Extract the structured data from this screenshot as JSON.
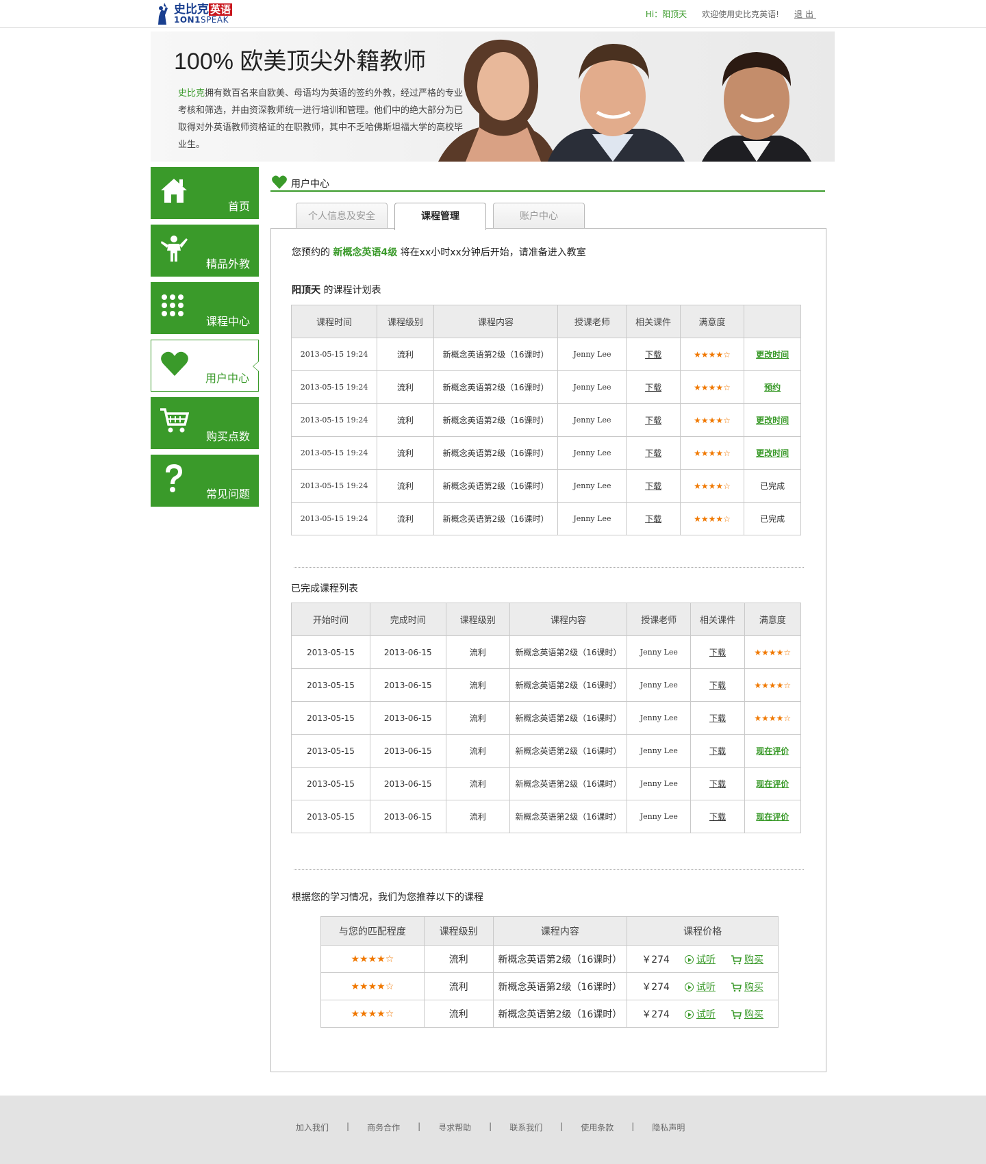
{
  "header": {
    "logo_cn": "史比克",
    "logo_cn_red": "英语",
    "logo_en_bold": "1ON1",
    "logo_en": "SPEAK",
    "greeting": "Hi：阳顶天",
    "welcome": "欢迎使用史比克英语!",
    "logout": "退出"
  },
  "banner": {
    "title": "100% 欧美顶尖外籍教师",
    "brand": "史比克",
    "text": "拥有数百名来自欧美、母语均为英语的签约外教，经过严格的专业考核和筛选，并由资深教师统一进行培训和管理。他们中的绝大部分为已取得对外英语教师资格证的在职教师，其中不乏哈佛斯坦福大学的高校毕业生。"
  },
  "sidebar": {
    "items": [
      {
        "label": "首页",
        "icon": "home-icon"
      },
      {
        "label": "精品外教",
        "icon": "teacher-icon"
      },
      {
        "label": "课程中心",
        "icon": "grid-icon"
      },
      {
        "label": "用户中心",
        "icon": "heart-icon",
        "active": true
      },
      {
        "label": "购买点数",
        "icon": "cart-icon"
      },
      {
        "label": "常见问题",
        "icon": "question-icon"
      }
    ]
  },
  "section": {
    "title": "用户中心"
  },
  "tabs": [
    "个人信息及安全",
    "课程管理",
    "账户中心"
  ],
  "notice": {
    "prefix": "您预约的",
    "course": "新概念英语4级",
    "suffix": "将在xx小时xx分钟后开始，请准备进入教室"
  },
  "plan": {
    "user": "阳顶天",
    "title_suffix": "的课程计划表",
    "headers": [
      "课程时间",
      "课程级别",
      "课程内容",
      "授课老师",
      "相关课件",
      "满意度",
      ""
    ],
    "rows": [
      {
        "time": "2013-05-15  19:24",
        "level": "流利",
        "content": "新概念英语第2级（16课时）",
        "teacher": "Jenny Lee",
        "file": "下载",
        "rating": 4,
        "action": "更改时间",
        "action_type": "link"
      },
      {
        "time": "2013-05-15  19:24",
        "level": "流利",
        "content": "新概念英语第2级（16课时）",
        "teacher": "Jenny Lee",
        "file": "下载",
        "rating": 4,
        "action": "预约",
        "action_type": "link"
      },
      {
        "time": "2013-05-15  19:24",
        "level": "流利",
        "content": "新概念英语第2级（16课时）",
        "teacher": "Jenny Lee",
        "file": "下载",
        "rating": 4,
        "action": "更改时间",
        "action_type": "link"
      },
      {
        "time": "2013-05-15  19:24",
        "level": "流利",
        "content": "新概念英语第2级（16课时）",
        "teacher": "Jenny Lee",
        "file": "下载",
        "rating": 4,
        "action": "更改时间",
        "action_type": "link"
      },
      {
        "time": "2013-05-15  19:24",
        "level": "流利",
        "content": "新概念英语第2级（16课时）",
        "teacher": "Jenny Lee",
        "file": "下载",
        "rating": 4,
        "action": "已完成",
        "action_type": "text"
      },
      {
        "time": "2013-05-15  19:24",
        "level": "流利",
        "content": "新概念英语第2级（16课时）",
        "teacher": "Jenny Lee",
        "file": "下载",
        "rating": 4,
        "action": "已完成",
        "action_type": "text"
      }
    ]
  },
  "completed": {
    "title": "已完成课程列表",
    "headers": [
      "开始时间",
      "完成时间",
      "课程级别",
      "课程内容",
      "授课老师",
      "相关课件",
      "满意度"
    ],
    "rows": [
      {
        "start": "2013-05-15",
        "end": "2013-06-15",
        "level": "流利",
        "content": "新概念英语第2级（16课时）",
        "teacher": "Jenny Lee",
        "file": "下载",
        "rating": 4,
        "eval": ""
      },
      {
        "start": "2013-05-15",
        "end": "2013-06-15",
        "level": "流利",
        "content": "新概念英语第2级（16课时）",
        "teacher": "Jenny Lee",
        "file": "下载",
        "rating": 4,
        "eval": ""
      },
      {
        "start": "2013-05-15",
        "end": "2013-06-15",
        "level": "流利",
        "content": "新概念英语第2级（16课时）",
        "teacher": "Jenny Lee",
        "file": "下载",
        "rating": 4,
        "eval": ""
      },
      {
        "start": "2013-05-15",
        "end": "2013-06-15",
        "level": "流利",
        "content": "新概念英语第2级（16课时）",
        "teacher": "Jenny Lee",
        "file": "下载",
        "rating": 0,
        "eval": "现在评价"
      },
      {
        "start": "2013-05-15",
        "end": "2013-06-15",
        "level": "流利",
        "content": "新概念英语第2级（16课时）",
        "teacher": "Jenny Lee",
        "file": "下载",
        "rating": 0,
        "eval": "现在评价"
      },
      {
        "start": "2013-05-15",
        "end": "2013-06-15",
        "level": "流利",
        "content": "新概念英语第2级（16课时）",
        "teacher": "Jenny Lee",
        "file": "下载",
        "rating": 0,
        "eval": "现在评价"
      }
    ]
  },
  "recommend": {
    "title": "根据您的学习情况，我们为您推荐以下的课程",
    "headers": [
      "与您的匹配程度",
      "课程级别",
      "课程内容",
      "课程价格"
    ],
    "rows": [
      {
        "match": 4,
        "level": "流利",
        "content": "新概念英语第2级（16课时）",
        "price": "￥274",
        "trial": "试听",
        "buy": "购买"
      },
      {
        "match": 4,
        "level": "流利",
        "content": "新概念英语第2级（16课时）",
        "price": "￥274",
        "trial": "试听",
        "buy": "购买"
      },
      {
        "match": 4,
        "level": "流利",
        "content": "新概念英语第2级（16课时）",
        "price": "￥274",
        "trial": "试听",
        "buy": "购买"
      }
    ]
  },
  "footer": {
    "links": [
      "加入我们",
      "商务合作",
      "寻求帮助",
      "联系我们",
      "使用条款",
      "隐私声明"
    ]
  },
  "colors": {
    "accent": "#3a9a2a",
    "star": "#f07800",
    "brand_blue": "#1a3f8f"
  }
}
